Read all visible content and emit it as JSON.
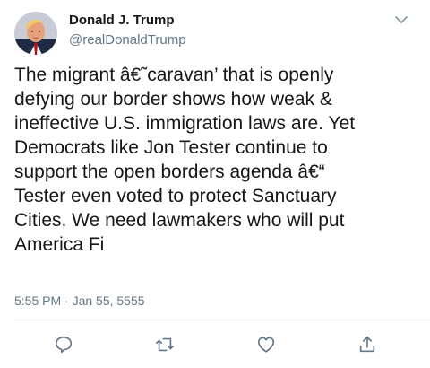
{
  "user": {
    "display_name": "Donald J. Trump",
    "handle": "@realDonaldTrump"
  },
  "tweet": {
    "lines": [
      "The migrant â€˜caravan’ that is openly",
      "defying our border shows how weak &",
      "ineffective U.S. immigration laws are. Yet",
      "Democrats like Jon Tester continue to",
      "support the open borders agenda â€“",
      "Tester even voted to protect Sanctuary",
      "Cities. We need lawmakers who will put",
      "America Fi"
    ],
    "timestamp": "5:55 PM · Jan 55, 5555"
  },
  "icons": {
    "menu": "chevron-down-icon",
    "reply": "reply-icon",
    "retweet": "retweet-icon",
    "like": "heart-icon",
    "share": "share-icon"
  },
  "colors": {
    "text_primary": "#14171a",
    "text_secondary": "#657786",
    "divider": "#e6ecf0",
    "icon": "#657786"
  }
}
